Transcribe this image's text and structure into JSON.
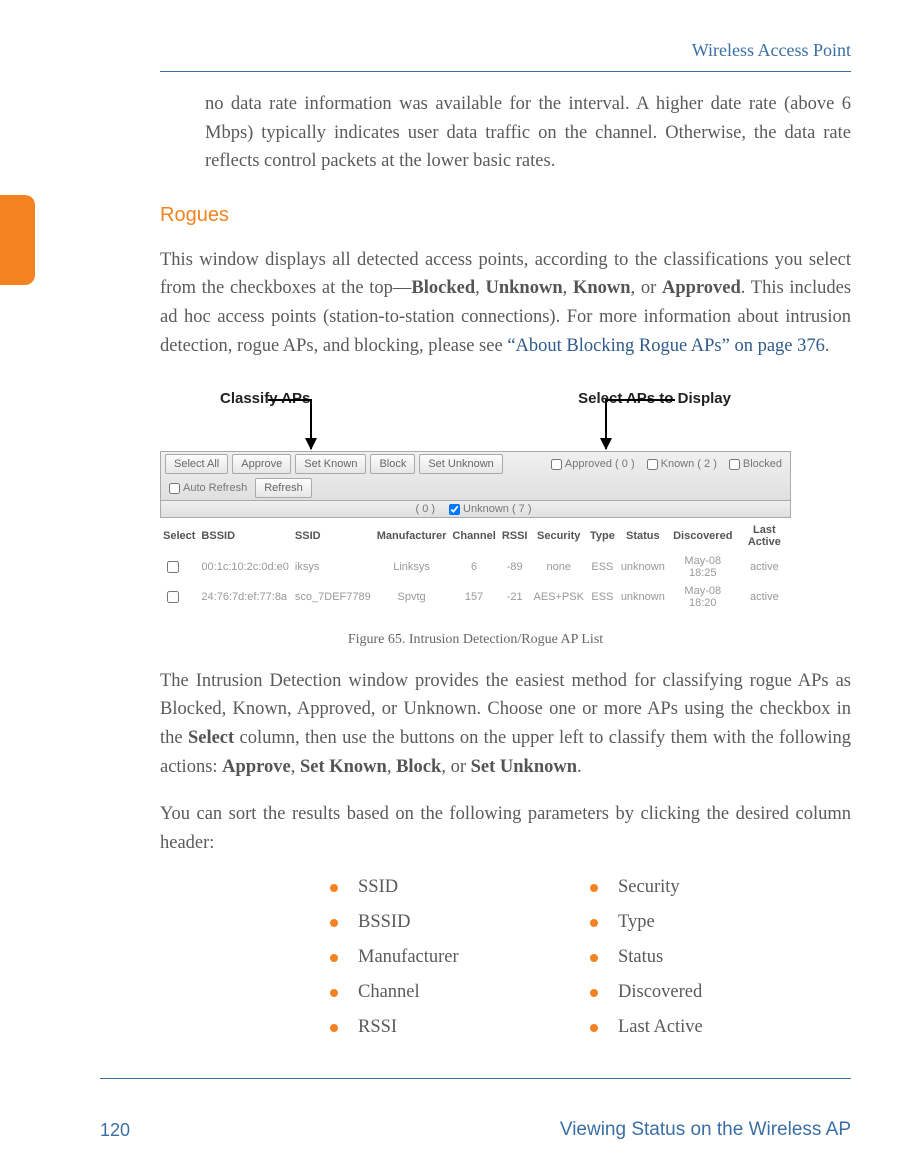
{
  "header": {
    "title": "Wireless Access Point"
  },
  "intro_para": "no data rate information was available for the interval. A higher date rate (above 6 Mbps) typically indicates user data traffic on the channel. Otherwise, the data rate reflects control packets at the lower basic rates.",
  "section_heading": "Rogues",
  "rogues_para_pre": "This window displays all detected access points, according to the classifications you select from the checkboxes at the top—",
  "rogues_bold1": "Blocked",
  "rogues_bold2": "Unknown",
  "rogues_bold3": "Known",
  "rogues_bold4": "Approved",
  "rogues_para_mid": ". This includes ad hoc access points (station-to-station connections). For more information about intrusion detection, rogue APs, and blocking, please see ",
  "rogues_link": "“About Blocking Rogue APs” on page 376",
  "rogues_para_end": ".",
  "callouts": {
    "left": "Classify APs",
    "right": "Select APs to Display"
  },
  "toolbar": {
    "select_all": "Select All",
    "approve": "Approve",
    "set_known": "Set Known",
    "block": "Block",
    "set_unknown": "Set Unknown",
    "approved_label": "Approved ( 0 )",
    "known_label": "Known ( 2 )",
    "blocked_label": "Blocked",
    "auto_refresh": "Auto Refresh",
    "refresh": "Refresh",
    "row2_left": "( 0 )",
    "row2_right": "Unknown ( 7 )"
  },
  "table": {
    "headers": {
      "select": "Select",
      "bssid": "BSSID",
      "ssid": "SSID",
      "manufacturer": "Manufacturer",
      "channel": "Channel",
      "rssi": "RSSI",
      "security": "Security",
      "type": "Type",
      "status": "Status",
      "discovered": "Discovered",
      "last_active": "Last Active"
    },
    "rows": [
      {
        "bssid": "00:1c:10:2c:0d:e0",
        "ssid": "iksys",
        "manufacturer": "Linksys",
        "channel": "6",
        "rssi": "-89",
        "security": "none",
        "type": "ESS",
        "status": "unknown",
        "discovered": "May-08 18:25",
        "last_active": "active"
      },
      {
        "bssid": "24:76:7d:ef:77:8a",
        "ssid": "sco_7DEF7789",
        "manufacturer": "Spvtg",
        "channel": "157",
        "rssi": "-21",
        "security": "AES+PSK",
        "type": "ESS",
        "status": "unknown",
        "discovered": "May-08 18:20",
        "last_active": "active"
      }
    ]
  },
  "figure_caption": "Figure 65. Intrusion Detection/Rogue AP List",
  "para2_pre": "The Intrusion Detection window provides the easiest method for classifying rogue APs as Blocked, Known, Approved, or Unknown. Choose one or more APs using the checkbox in the ",
  "para2_bold1": "Select",
  "para2_mid1": " column, then use the buttons on the upper left to classify them with the following actions: ",
  "para2_bold2": "Approve",
  "para2_bold3": "Set Known",
  "para2_bold4": "Block",
  "para2_bold5": "Set Unknown",
  "para2_end": ".",
  "para3": "You can sort the results based on the following parameters by clicking the desired column header:",
  "params": {
    "c1": [
      "SSID",
      "BSSID",
      "Manufacturer",
      "Channel",
      "RSSI"
    ],
    "c2": [
      "Security",
      "Type",
      "Status",
      "Discovered",
      "Last Active"
    ]
  },
  "footer": {
    "page": "120",
    "text": "Viewing Status on the Wireless AP"
  }
}
